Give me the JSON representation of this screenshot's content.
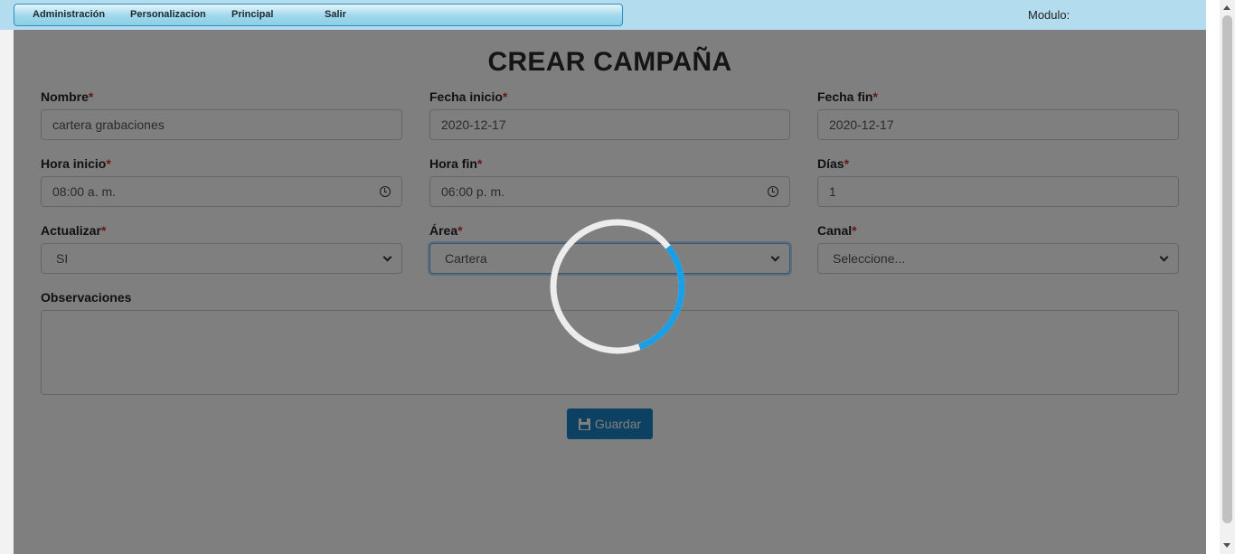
{
  "menu": {
    "items": [
      "Administración",
      "Personalizacion",
      "Principal",
      "Salir"
    ],
    "modulo_label": "Modulo:"
  },
  "form": {
    "title": "CREAR CAMPAÑA",
    "required_marker": "*",
    "nombre": {
      "label": "Nombre",
      "value": "cartera grabaciones"
    },
    "fecha_inicio": {
      "label": "Fecha inicio",
      "value": "2020-12-17"
    },
    "fecha_fin": {
      "label": "Fecha fin",
      "value": "2020-12-17"
    },
    "hora_inicio": {
      "label": "Hora inicio",
      "value": "08:00 a. m."
    },
    "hora_fin": {
      "label": "Hora fin",
      "value": "06:00 p. m."
    },
    "dias": {
      "label": "Días",
      "value": "1"
    },
    "actualizar": {
      "label": "Actualizar",
      "value": "SI"
    },
    "area": {
      "label": "Área",
      "value": "Cartera"
    },
    "canal": {
      "label": "Canal",
      "value": "Seleccione..."
    },
    "observaciones": {
      "label": "Observaciones",
      "value": ""
    },
    "save_label": "Guardar"
  },
  "colors": {
    "accent": "#1b82c2",
    "required": "#d32f2f",
    "spinner_progress": "#1a9ee6",
    "topbar": "#b3dcef"
  },
  "spinner": {
    "progress": 0.3
  }
}
